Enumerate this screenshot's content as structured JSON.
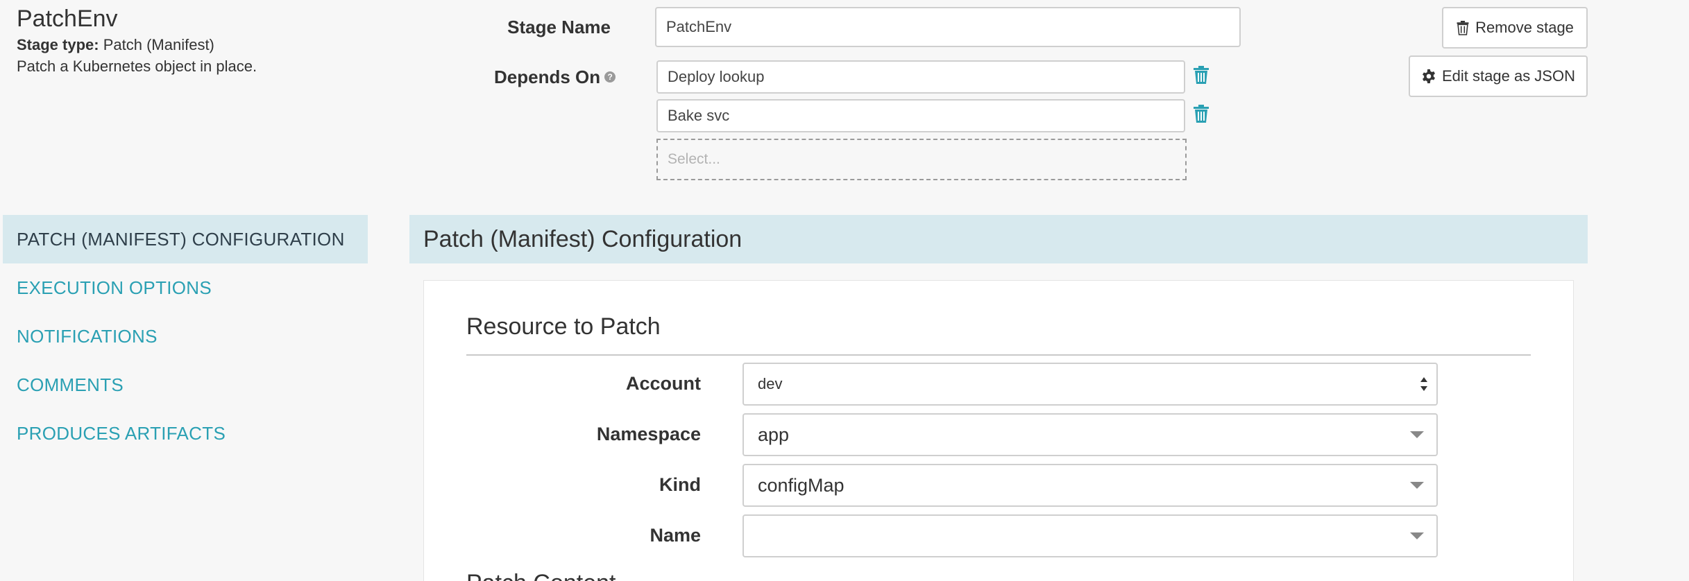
{
  "stage": {
    "title": "PatchEnv",
    "type_label": "Stage type:",
    "type_value": "Patch (Manifest)",
    "description": "Patch a Kubernetes object in place."
  },
  "form": {
    "stage_name_label": "Stage Name",
    "stage_name_value": "PatchEnv",
    "depends_on_label": "Depends On",
    "depends_on": [
      "Deploy lookup",
      "Bake svc"
    ],
    "depends_on_placeholder": "Select..."
  },
  "actions": {
    "remove_stage": "Remove stage",
    "edit_json": "Edit stage as JSON"
  },
  "nav": {
    "items": [
      {
        "label": "PATCH (MANIFEST) CONFIGURATION",
        "active": true
      },
      {
        "label": "EXECUTION OPTIONS",
        "active": false
      },
      {
        "label": "NOTIFICATIONS",
        "active": false
      },
      {
        "label": "COMMENTS",
        "active": false
      },
      {
        "label": "PRODUCES ARTIFACTS",
        "active": false
      }
    ]
  },
  "config": {
    "section_title": "Patch (Manifest) Configuration",
    "resource_title": "Resource to Patch",
    "fields": {
      "account": {
        "label": "Account",
        "value": "dev"
      },
      "namespace": {
        "label": "Namespace",
        "value": "app"
      },
      "kind": {
        "label": "Kind",
        "value": "configMap"
      },
      "name": {
        "label": "Name",
        "value": ""
      }
    },
    "next_heading": "Patch Content"
  },
  "colors": {
    "accent": "#2aa0b3",
    "nav_active_bg": "#d7e9ee",
    "page_bg": "#f7f7f7"
  },
  "icons": {
    "trash": "trash-icon",
    "gear": "gear-icon",
    "help": "question-circle-icon"
  }
}
